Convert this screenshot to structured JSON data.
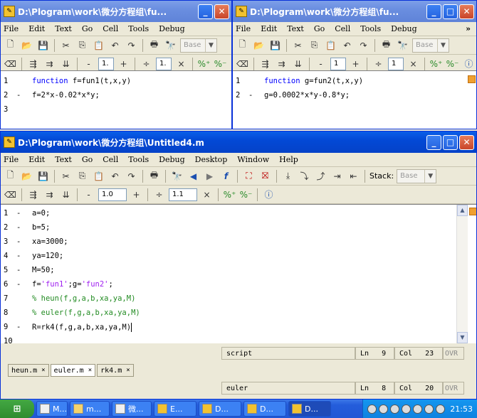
{
  "left_window": {
    "title": "D:\\Plogram\\work\\微分方程组\\fu...",
    "menu": [
      "File",
      "Edit",
      "Text",
      "Go",
      "Cell",
      "Tools",
      "Debug"
    ],
    "toolbar": {
      "stack_combo": "Base",
      "step_minus": "-",
      "step_value": "1.",
      "step_plus": "+",
      "divide": "÷",
      "div_value": "1.",
      "times": "×"
    },
    "lines": [
      {
        "num": "1",
        "dash": "",
        "kw": "function",
        "rest": " f=fun1(t,x,y)"
      },
      {
        "num": "2",
        "dash": "-",
        "kw": "",
        "rest": "f=2*x-0.02*x*y;"
      },
      {
        "num": "3",
        "dash": "",
        "kw": "",
        "rest": ""
      }
    ]
  },
  "right_window": {
    "title": "D:\\Plogram\\work\\微分方程组\\fu...",
    "menu": [
      "File",
      "Edit",
      "Text",
      "Go",
      "Cell",
      "Tools",
      "Debug"
    ],
    "more": "»",
    "toolbar": {
      "stack_combo": "Base",
      "step_minus": "-",
      "step_value": "1",
      "step_plus": "+",
      "divide": "÷",
      "div_value": "1",
      "times": "×"
    },
    "lines": [
      {
        "num": "1",
        "dash": "",
        "kw": "function",
        "rest": " g=fun2(t,x,y)"
      },
      {
        "num": "2",
        "dash": "-",
        "kw": "",
        "rest": "g=0.0002*x*y-0.8*y;"
      }
    ]
  },
  "main_window": {
    "title": "D:\\Plogram\\work\\微分方程组\\Untitled4.m",
    "menu": [
      "File",
      "Edit",
      "Text",
      "Go",
      "Cell",
      "Tools",
      "Debug",
      "Desktop",
      "Window",
      "Help"
    ],
    "toolbar": {
      "stack_label": "Stack:",
      "stack_combo": "Base",
      "step_minus": "-",
      "step_value": "1.0",
      "step_plus": "+",
      "divide": "÷",
      "div_value": "1.1",
      "times": "×"
    },
    "lines": [
      {
        "num": "1",
        "dash": "-",
        "parts": [
          {
            "t": "a=0;",
            "c": ""
          }
        ]
      },
      {
        "num": "2",
        "dash": "-",
        "parts": [
          {
            "t": "b=5;",
            "c": ""
          }
        ]
      },
      {
        "num": "3",
        "dash": "-",
        "parts": [
          {
            "t": "xa=3000;",
            "c": ""
          }
        ]
      },
      {
        "num": "4",
        "dash": "-",
        "parts": [
          {
            "t": "ya=120;",
            "c": ""
          }
        ]
      },
      {
        "num": "5",
        "dash": "-",
        "parts": [
          {
            "t": "M=50;",
            "c": ""
          }
        ]
      },
      {
        "num": "6",
        "dash": "-",
        "parts": [
          {
            "t": "f=",
            "c": ""
          },
          {
            "t": "'fun1'",
            "c": "str"
          },
          {
            "t": ";g=",
            "c": ""
          },
          {
            "t": "'fun2'",
            "c": "str"
          },
          {
            "t": ";",
            "c": ""
          }
        ]
      },
      {
        "num": "7",
        "dash": "",
        "parts": [
          {
            "t": "% heun(f,g,a,b,xa,ya,M)",
            "c": "cmt"
          }
        ]
      },
      {
        "num": "8",
        "dash": "",
        "parts": [
          {
            "t": "% euler(f,g,a,b,xa,ya,M)",
            "c": "cmt"
          }
        ]
      },
      {
        "num": "9",
        "dash": "-",
        "parts": [
          {
            "t": "R=rk4(f,g,a,b,xa,ya,M)",
            "c": ""
          }
        ]
      },
      {
        "num": "10",
        "dash": "",
        "parts": []
      }
    ],
    "status": {
      "mode": "script",
      "ln_label": "Ln",
      "ln": "9",
      "col_label": "Col",
      "col": "23",
      "ovr": "OVR"
    }
  },
  "tabs": [
    {
      "label": "heun.m",
      "close": "×"
    },
    {
      "label": "euler.m",
      "close": "×"
    },
    {
      "label": "rk4.m",
      "close": "×"
    }
  ],
  "bottom_status": {
    "mode": "euler",
    "ln_label": "Ln",
    "ln": "8",
    "col_label": "Col",
    "col": "20",
    "ovr": "OVR"
  },
  "taskbar": {
    "tasks": [
      "M...",
      "m...",
      "微...",
      "E...",
      "D...",
      "D...",
      "D..."
    ],
    "clock": "21:53"
  }
}
